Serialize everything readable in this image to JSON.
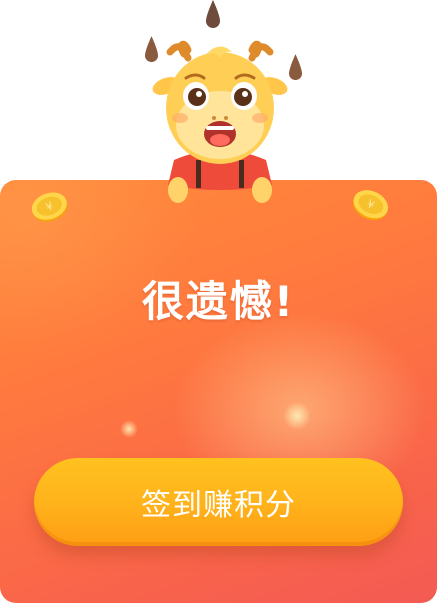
{
  "dialog": {
    "title": "很遗憾!",
    "cta_label": "签到赚积分"
  },
  "icons": {
    "mascot": "sad-deer-mascot-icon",
    "coin": "gold-coin-icon",
    "drop": "sweat-drop-icon"
  },
  "colors": {
    "card_top": "#ff8a3a",
    "card_bottom": "#f35a53",
    "button": "#ffb31b",
    "title": "#ffffff"
  }
}
